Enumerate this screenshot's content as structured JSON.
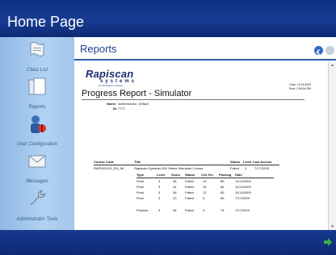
{
  "window": {
    "title": "Home Page"
  },
  "sidebar": {
    "items": [
      {
        "label": "Class List",
        "icon": "scroll-icon"
      },
      {
        "label": "Reports",
        "icon": "documents-icon"
      },
      {
        "label": "User Configuration",
        "icon": "user-config-icon"
      },
      {
        "label": "Messages",
        "icon": "envelope-icon"
      },
      {
        "label": "Administrator Tools",
        "icon": "wrench-icon"
      }
    ]
  },
  "main": {
    "header": "Reports"
  },
  "report": {
    "brand": "Rapiscan",
    "brand_sub": "systems",
    "brand_tag": "An OSI Systems Company",
    "date_label": "Date: 11/13/2009",
    "time_label": "Time: 2:56:54 PM",
    "title": "Progress Report - Simulator",
    "name_label": "Name:",
    "name_value": "Administrator, Default",
    "id_label": "ID:",
    "id_value": "7777",
    "columns": [
      "Course Code",
      "Title",
      "Status",
      "Level",
      "Last Access"
    ],
    "course": {
      "code": "RAPI500120_EN_IM",
      "title": "Rapiscan Systems 600 Series Simulator Course",
      "status": "Failed",
      "level": "3",
      "last_access": "7/17/2009"
    },
    "sub_columns": [
      "Type",
      "Level",
      "Score",
      "Status",
      "Crit. Err.",
      "Passing",
      "Date"
    ],
    "rows": [
      {
        "type": "Final",
        "level": "3",
        "score": "36",
        "status": "Failed",
        "crit": "10",
        "passing": "85",
        "date": "11/13/2009"
      },
      {
        "type": "Final",
        "level": "3",
        "score": "24",
        "status": "Failed",
        "crit": "16",
        "passing": "85",
        "date": "11/13/2009"
      },
      {
        "type": "Final",
        "level": "3",
        "score": "36",
        "status": "Failed",
        "crit": "12",
        "passing": "85",
        "date": "11/13/2009"
      },
      {
        "type": "Final",
        "level": "3",
        "score": "20",
        "status": "Failed",
        "crit": "5",
        "passing": "85",
        "date": "7/17/2009"
      },
      {
        "type": "Practice",
        "level": "3",
        "score": "46",
        "status": "Failed",
        "crit": "3",
        "passing": "75",
        "date": "7/17/2009"
      }
    ]
  }
}
